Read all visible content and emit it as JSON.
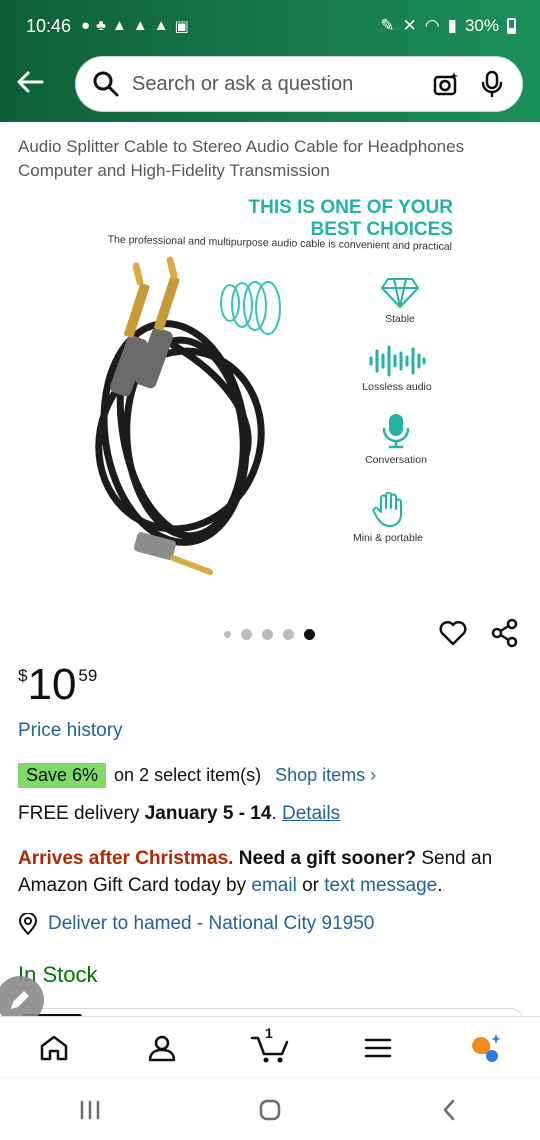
{
  "status_bar": {
    "time": "10:46",
    "battery": "30%"
  },
  "search": {
    "placeholder": "Search or ask a question"
  },
  "product": {
    "title": "Audio Splitter Cable to Stereo Audio Cable for Headphones Computer and High-Fidelity Transmission",
    "image_headline_line1": "THIS IS ONE OF YOUR",
    "image_headline_line2": "BEST CHOICES",
    "image_subtitle": "The professional and multipurpose audio cable is convenient and practical",
    "features": [
      {
        "label": "Stable",
        "icon": "diamond-icon"
      },
      {
        "label": "Lossless audio",
        "icon": "sound-wave-icon"
      },
      {
        "label": "Conversation",
        "icon": "microphone-icon"
      },
      {
        "label": "Mini & portable",
        "icon": "hand-icon"
      }
    ],
    "image_count": 5,
    "active_image_index": 4
  },
  "price": {
    "currency": "$",
    "whole": "10",
    "fraction": "59"
  },
  "price_history_label": "Price history",
  "promo": {
    "badge": "Save 6%",
    "text": "on 2 select item(s)",
    "link": "Shop items ›"
  },
  "delivery": {
    "prefix": "FREE delivery ",
    "dates": "January 5 - 14",
    "suffix": ". ",
    "details_link": "Details"
  },
  "xmas_notice": {
    "warning": "Arrives after Christmas.",
    "question": " Need a gift sooner?",
    "text1": " Send an Amazon Gift Card today by ",
    "email_link": "email",
    "text2": " or ",
    "text_link": "text message",
    "text3": "."
  },
  "deliver_to": "Deliver to hamed - National City 91950",
  "stock_status": "In Stock",
  "bottom_nav": {
    "cart_count": "1"
  },
  "colors": {
    "header_green": "#18794e",
    "link_blue": "#2162a1",
    "price_red": "#b12704",
    "in_stock_green": "#007600",
    "save_badge": "#7fda69",
    "teal_accent": "#21b3a4"
  }
}
